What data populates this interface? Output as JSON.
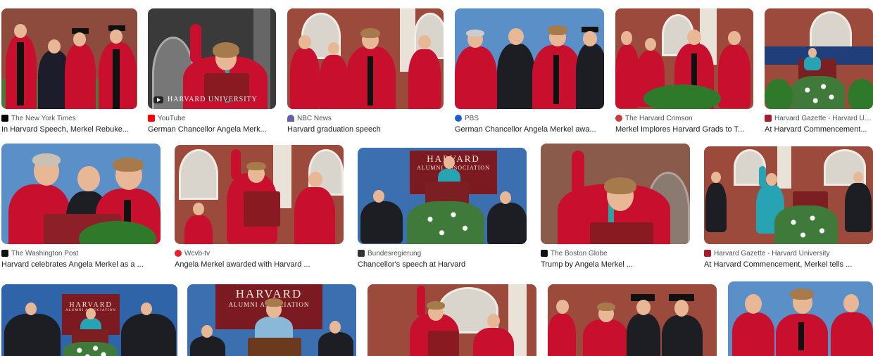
{
  "colors": {
    "gown_red": "#c8102e",
    "harvard_crimson": "#7b1a20",
    "brick": "#9b4a3c",
    "sky_blue": "#5b8fc7",
    "link_text": "#202124",
    "source_text": "#4d5156"
  },
  "results": [
    {
      "source": "The New York Times",
      "favicon": "nyt-icon",
      "favicon_color": "#000000",
      "title": "In Harvard Speech, Merkel Rebuke..."
    },
    {
      "source": "YouTube",
      "favicon": "youtube-icon",
      "favicon_color": "#ff0000",
      "title": "German Chancellor Angela Merk...",
      "overlay_text": "HARVARD UNIVERSITY"
    },
    {
      "source": "NBC News",
      "favicon": "nbc-icon",
      "favicon_color": "#6460aa",
      "title": "Harvard graduation speech"
    },
    {
      "source": "PBS",
      "favicon": "pbs-icon",
      "favicon_color": "#1f5fcf",
      "title": "German Chancellor Angela Merkel awa..."
    },
    {
      "source": "The Harvard Crimson",
      "favicon": "crimson-icon",
      "favicon_color": "#c93b3b",
      "title": "Merkel Implores Harvard Grads to T..."
    },
    {
      "source": "Harvard Gazette - Harvard Un...",
      "favicon": "harvard-gazette-icon",
      "favicon_color": "#a51c30",
      "title": "At Harvard Commencement..."
    },
    {
      "source": "The Washington Post",
      "favicon": "wapo-icon",
      "favicon_color": "#111111",
      "title": "Harvard celebrates Angela Merkel as a ..."
    },
    {
      "source": "Wcvb-tv",
      "favicon": "wcvb-icon",
      "favicon_color": "#e0242a",
      "title": "Angela Merkel awarded with Harvard ..."
    },
    {
      "source": "Bundesregierung",
      "favicon": "bundesregierung-icon",
      "favicon_color": "#333333",
      "title": "Chancellor's speech at Harvard",
      "banner_line1": "HARVARD",
      "banner_line2": "ALUMNI ASSOCIATION"
    },
    {
      "source": "The Boston Globe",
      "favicon": "boston-globe-icon",
      "favicon_color": "#111111",
      "title": "Trump by Angela Merkel ..."
    },
    {
      "source": "Harvard Gazette - Harvard University",
      "favicon": "harvard-gazette-icon",
      "favicon_color": "#a51c30",
      "title": "At Harvard Commencement, Merkel tells ..."
    },
    {
      "source": "",
      "favicon": "",
      "favicon_color": "",
      "title": "",
      "banner_line1": "HARVARD",
      "banner_line2": "ALUMNI ASSOCIATION"
    },
    {
      "source": "",
      "favicon": "",
      "favicon_color": "",
      "title": "",
      "banner_line1": "HARVARD",
      "banner_line2": "ALUMNI ASSOCIATION"
    },
    {
      "source": "",
      "favicon": "",
      "favicon_color": "",
      "title": ""
    },
    {
      "source": "",
      "favicon": "",
      "favicon_color": "",
      "title": ""
    },
    {
      "source": "",
      "favicon": "",
      "favicon_color": "",
      "title": ""
    }
  ]
}
